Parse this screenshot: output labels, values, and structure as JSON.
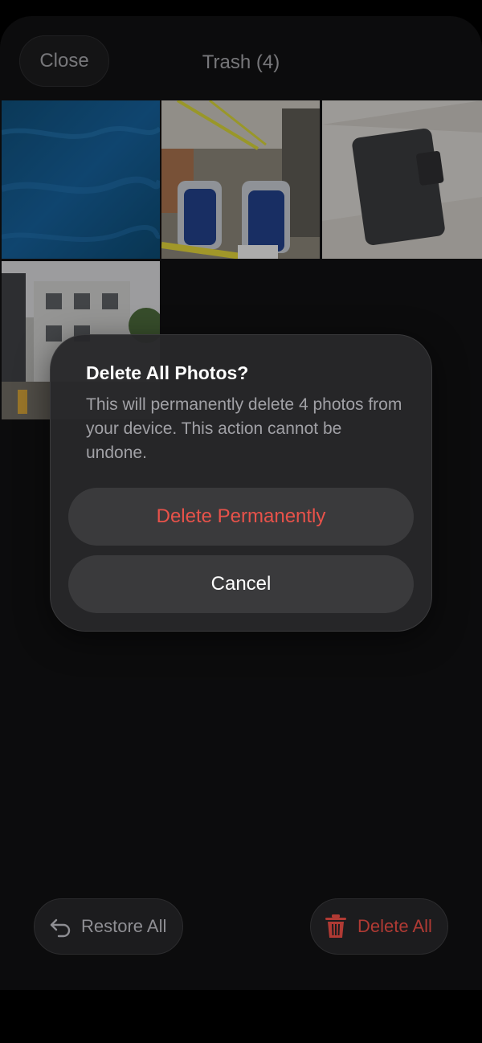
{
  "header": {
    "close_label": "Close",
    "title": "Trash (4)"
  },
  "photos": [
    "ocean-water-photo",
    "bus-interior-photo",
    "tablet-case-photo",
    "street-buildings-photo"
  ],
  "dialog": {
    "title": "Delete All Photos?",
    "message": "This will permanently delete 4 photos from your device. This action cannot be undone.",
    "delete_label": "Delete Permanently",
    "cancel_label": "Cancel"
  },
  "footer": {
    "restore_label": "Restore All",
    "delete_label": "Delete All"
  },
  "colors": {
    "destructive": "#e8524a",
    "background": "#111112"
  }
}
